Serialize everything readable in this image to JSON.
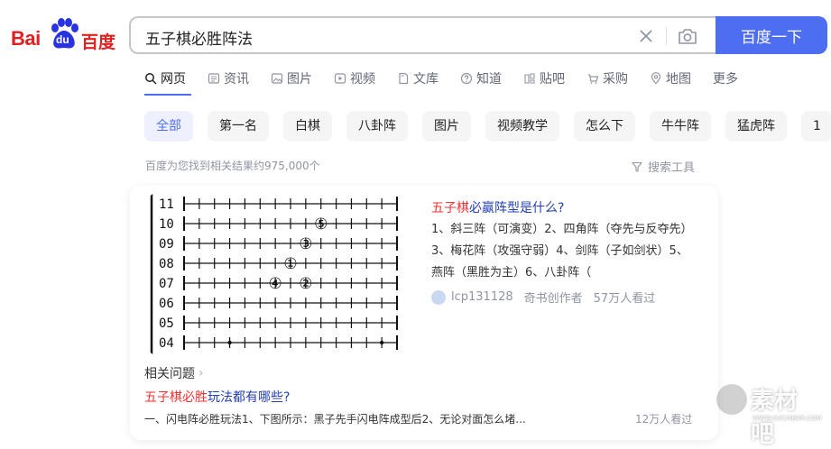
{
  "logo": {
    "latin": "Bai",
    "du": "du",
    "chinese": "百度"
  },
  "search": {
    "query": "五子棋必胜阵法",
    "button_label": "百度一下"
  },
  "tabs": [
    {
      "label": "网页",
      "icon": "search-icon"
    },
    {
      "label": "资讯",
      "icon": "news-icon"
    },
    {
      "label": "图片",
      "icon": "image-icon"
    },
    {
      "label": "视频",
      "icon": "video-icon"
    },
    {
      "label": "文库",
      "icon": "doc-icon"
    },
    {
      "label": "知道",
      "icon": "question-icon"
    },
    {
      "label": "贴吧",
      "icon": "tieba-icon"
    },
    {
      "label": "采购",
      "icon": "cart-icon"
    },
    {
      "label": "地图",
      "icon": "map-icon"
    },
    {
      "label": "更多",
      "icon": ""
    }
  ],
  "chips": [
    "全部",
    "第一名",
    "白棋",
    "八卦阵",
    "图片",
    "视频教学",
    "怎么下",
    "牛牛阵",
    "猛虎阵",
    "1"
  ],
  "result_count": "百度为您找到相关结果约975,000个",
  "tools_label": "搜索工具",
  "card": {
    "board_rows": [
      "11",
      "10",
      "09",
      "08",
      "07",
      "06",
      "05",
      "04"
    ],
    "board_stones": [
      "⑤",
      "③",
      "①",
      "④",
      "②"
    ],
    "title_highlight": "五子棋",
    "title_rest": "必赢阵型是什么?",
    "body": "1、斜三阵（可演变）2、四角阵（夺先与反夺先）3、梅花阵（攻强守弱）4、剑阵（子如剑状）5、燕阵（黑胜为主）6、八卦阵（",
    "author": "lcp131128",
    "author_role": "奇书创作者",
    "views": "57万人看过",
    "related_heading": "相关问题",
    "related_q_highlight": "五子棋必胜",
    "related_q_rest": "玩法都有哪些?",
    "related_snippet": "一、闪电阵必胜玩法1、下图所示：黑子先手闪电阵成型后2、无论对面怎么堵...",
    "related_views": "12万人看过"
  },
  "watermark": {
    "text": "素材吧",
    "sub": "WWW.SUCAIBAR.COM"
  }
}
